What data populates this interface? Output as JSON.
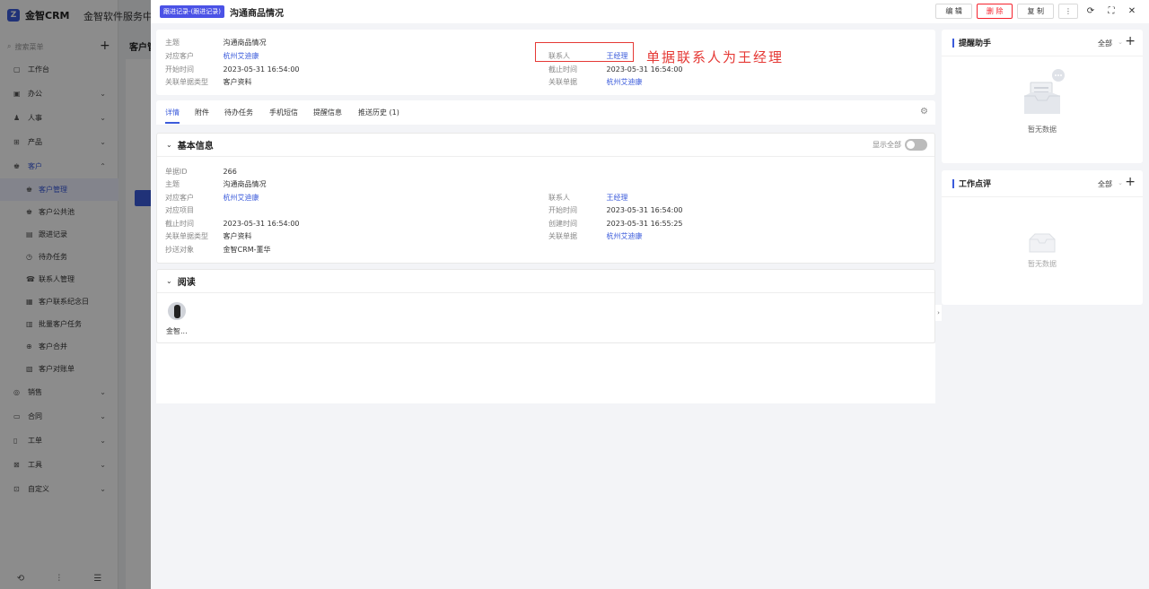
{
  "background": {
    "logo_text": "金智CRM",
    "app_title": "金智软件服务中心",
    "search_placeholder": "搜索菜单",
    "content_title": "客户管",
    "menu": [
      {
        "icon": "▢",
        "label": "工作台"
      },
      {
        "icon": "▣",
        "label": "办公",
        "caret": "⌄"
      },
      {
        "icon": "♟",
        "label": "人事",
        "caret": "⌄"
      },
      {
        "icon": "⊞",
        "label": "产品",
        "caret": "⌄"
      },
      {
        "icon": "♚",
        "label": "客户",
        "caret": "⌃"
      }
    ],
    "submenu": [
      {
        "icon": "♚",
        "label": "客户管理"
      },
      {
        "icon": "♚",
        "label": "客户公共池"
      },
      {
        "icon": "▤",
        "label": "跟进记录"
      },
      {
        "icon": "◷",
        "label": "待办任务"
      },
      {
        "icon": "☎",
        "label": "联系人管理"
      },
      {
        "icon": "▦",
        "label": "客户联系纪念日"
      },
      {
        "icon": "▥",
        "label": "批量客户任务"
      },
      {
        "icon": "⊕",
        "label": "客户合并"
      },
      {
        "icon": "▧",
        "label": "客户对账单"
      }
    ],
    "menu2": [
      {
        "icon": "◎",
        "label": "销售",
        "caret": "⌄"
      },
      {
        "icon": "▭",
        "label": "合同",
        "caret": "⌄"
      },
      {
        "icon": "▯",
        "label": "工单",
        "caret": "⌄"
      },
      {
        "icon": "⊠",
        "label": "工具",
        "caret": "⌄"
      },
      {
        "icon": "⊡",
        "label": "自定义",
        "caret": "⌄"
      }
    ]
  },
  "drawer": {
    "badge": "跟进记录-(跟进记录)",
    "title": "沟通商品情况",
    "actions": {
      "edit": "编 辑",
      "delete": "删 除",
      "copy": "复 制",
      "more": "⋮"
    },
    "summary": {
      "subject_label": "主题",
      "subject_value": "沟通商品情况",
      "customer_label": "对应客户",
      "customer_value": "杭州艾迪康",
      "start_label": "开始时间",
      "start_value": "2023-05-31 16:54:00",
      "doctype_label": "关联单据类型",
      "doctype_value": "客户资料",
      "contact_label": "联系人",
      "contact_value": "王经理",
      "deadline_label": "截止时间",
      "deadline_value": "2023-05-31 16:54:00",
      "linkdoc_label": "关联单据",
      "linkdoc_value": "杭州艾迪康"
    },
    "annotation": "单据联系人为王经理",
    "tabs": [
      "详情",
      "附件",
      "待办任务",
      "手机短信",
      "提醒信息",
      "推送历史 (1)"
    ],
    "basic": {
      "title": "基本信息",
      "show_all": "显示全部",
      "left": [
        {
          "label": "单据ID",
          "value": "266"
        },
        {
          "label": "主题",
          "value": "沟通商品情况"
        },
        {
          "label": "对应客户",
          "value": "杭州艾迪康",
          "link": true
        },
        {
          "label": "对应项目",
          "value": ""
        },
        {
          "label": "截止时间",
          "value": "2023-05-31 16:54:00"
        },
        {
          "label": "关联单据类型",
          "value": "客户资料"
        },
        {
          "label": "抄送对象",
          "value": "金智CRM-董华"
        }
      ],
      "right": [
        {
          "label": "联系人",
          "value": "王经理",
          "link": true
        },
        {
          "label": "开始时间",
          "value": "2023-05-31 16:54:00"
        },
        {
          "label": "创建时间",
          "value": "2023-05-31 16:55:25"
        },
        {
          "label": "关联单据",
          "value": "杭州艾迪康",
          "link": true
        }
      ]
    },
    "read": {
      "title": "阅读",
      "reader_name": "金智..."
    },
    "sidebar": {
      "reminder": {
        "title": "提醒助手",
        "filter": "全部",
        "empty": "暂无数据"
      },
      "review": {
        "title": "工作点评",
        "filter": "全部",
        "empty": "暂无数据"
      }
    }
  }
}
